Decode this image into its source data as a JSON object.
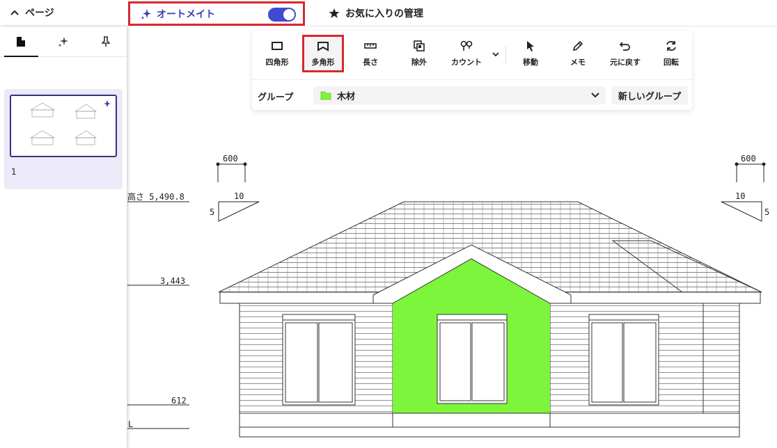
{
  "topbar": {
    "pages_label": "ページ",
    "automate_label": "オートメイト",
    "automate_on": true,
    "favorites_label": "お気に入りの管理"
  },
  "sidebar": {
    "tabs": [
      {
        "icon": "document-icon",
        "active": true
      },
      {
        "icon": "sparkle-icon",
        "active": false
      },
      {
        "icon": "pin-icon",
        "active": false
      }
    ],
    "page_number": "1"
  },
  "toolbar": {
    "tools": [
      {
        "label": "四角形",
        "icon": "rectangle-icon"
      },
      {
        "label": "多角形",
        "icon": "polygon-icon",
        "selected": true
      },
      {
        "label": "長さ",
        "icon": "ruler-icon"
      },
      {
        "label": "除外",
        "icon": "exclude-icon"
      },
      {
        "label": "カウント",
        "icon": "count-icon"
      },
      {
        "label": "移動",
        "icon": "cursor-icon"
      },
      {
        "label": "メモ",
        "icon": "pen-icon"
      },
      {
        "label": "元に戻す",
        "icon": "undo-icon"
      },
      {
        "label": "回転",
        "icon": "rotate-icon"
      }
    ],
    "group_label": "グループ",
    "group_value": "木材",
    "group_color": "#7cf53c",
    "new_group_label": "新しいグループ"
  },
  "drawing": {
    "dim_left_top": "600",
    "dim_right_top": "600",
    "slope_left_run": "10",
    "slope_left_rise": "5",
    "slope_right_run": "10",
    "slope_right_rise": "5",
    "height_label": "高さ 5,490.8",
    "level_3443": "3,443",
    "level_612": "612",
    "level_l": "L"
  },
  "colors": {
    "accent": "#3f4bd0",
    "highlight_red": "#d9282f",
    "fill_green": "#7cf53c"
  }
}
